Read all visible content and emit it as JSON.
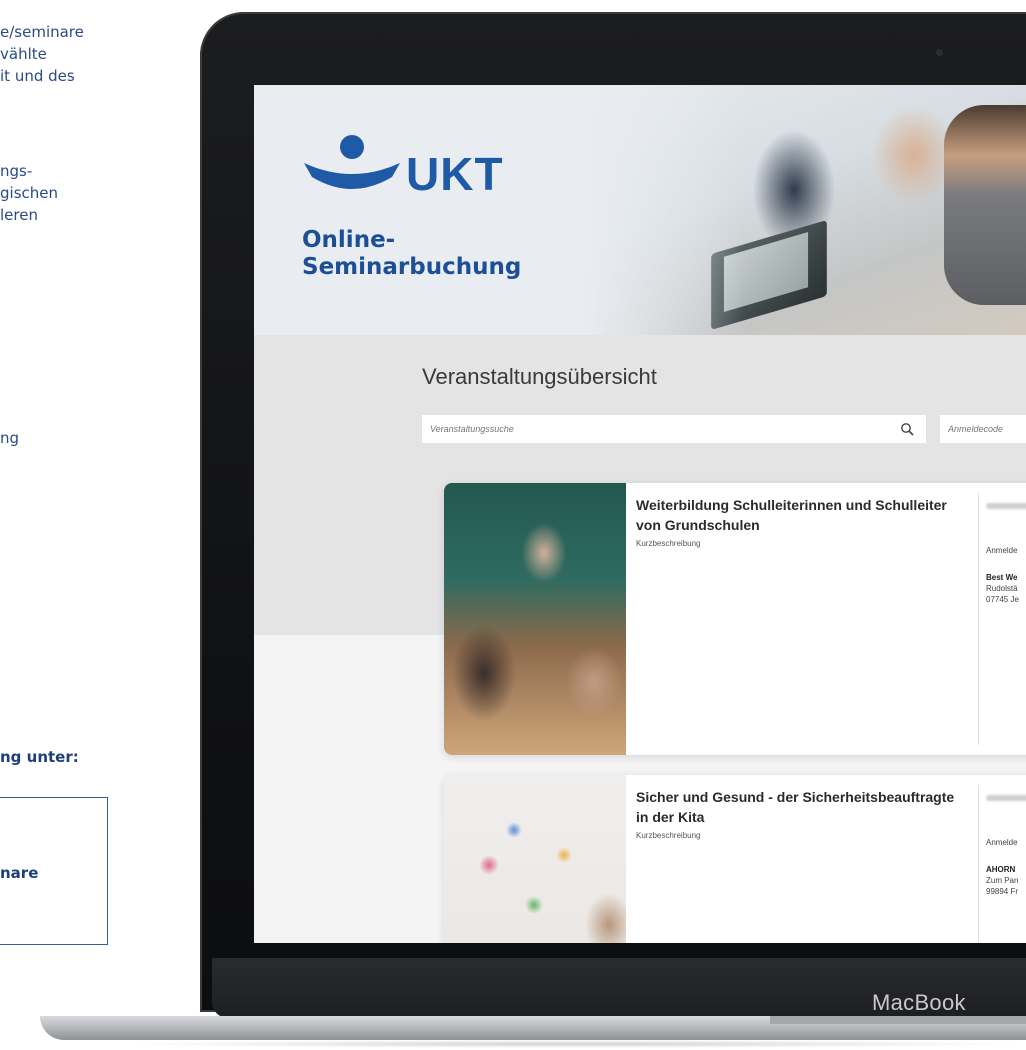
{
  "side_text": {
    "lines": [
      "e/seminare",
      "vählte",
      "it und des",
      "ngs-",
      "gischen",
      "leren",
      "ng"
    ],
    "bold_line": "ng unter:",
    "box_text": "nare"
  },
  "device": {
    "label": "MacBook"
  },
  "app": {
    "brand": "UKT",
    "subtitle": "Online-\nSeminarbuchung",
    "page_title": "Veranstaltungsübersicht",
    "search": {
      "placeholder": "Veranstaltungssuche",
      "icon": "search-icon"
    },
    "code": {
      "placeholder": "Anmeldecode"
    },
    "colors": {
      "brand_blue": "#1e5aa6",
      "bg_hero": "#e9edf1",
      "bg_body": "#e4e4e5"
    }
  },
  "events": [
    {
      "title": "Weiterbildung Schulleiterinnen und Schulleiter von Grundschulen",
      "description": "Kurzbeschreibung",
      "meta_label": "Anmelde",
      "venue": "Best We",
      "address1": "Rudolstä",
      "address2": "07745 Je"
    },
    {
      "title": "Sicher und Gesund - der Sicherheitsbeauftragte in der Kita",
      "description": "Kurzbeschreibung",
      "meta_label": "Anmelde",
      "venue": "AHORN",
      "address1": "Zum Pan",
      "address2": "99894 Fr"
    }
  ]
}
